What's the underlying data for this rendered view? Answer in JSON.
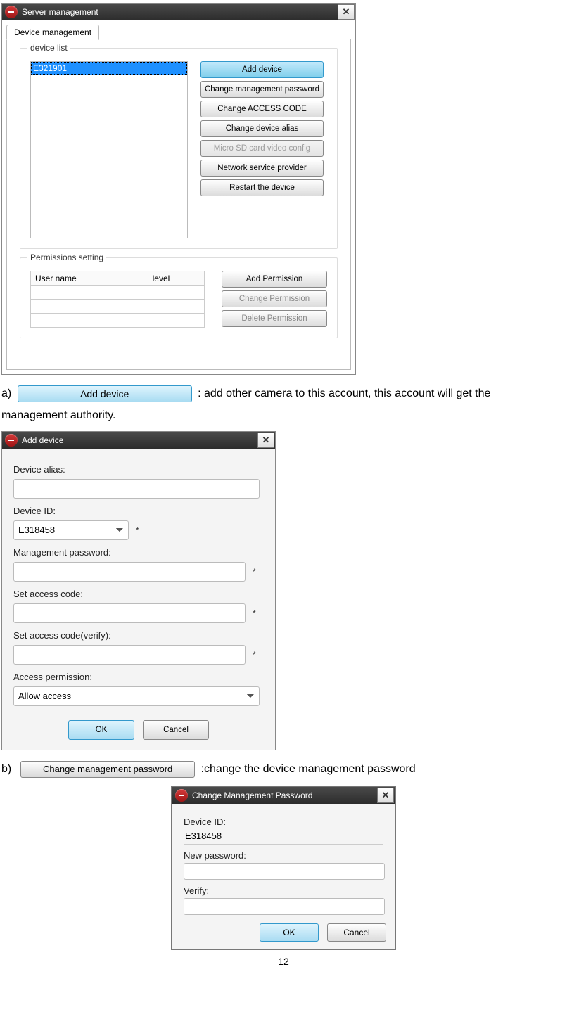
{
  "page_number": "12",
  "serverMgmt": {
    "title": "Server management",
    "tab": "Device management",
    "groupDeviceList": "device list",
    "deviceItems": [
      "E321901"
    ],
    "deviceButtons": {
      "add": "Add device",
      "changePwd": "Change management password",
      "changeAccess": "Change ACCESS CODE",
      "changeAlias": "Change device alias",
      "sd": "Micro SD card video config",
      "nsp": "Network service provider",
      "restart": "Restart the device"
    },
    "groupPermissions": "Permissions setting",
    "permHeaders": {
      "user": "User name",
      "level": "level"
    },
    "permButtons": {
      "add": "Add Permission",
      "change": "Change Permission",
      "delete": "Delete Permission"
    }
  },
  "proseA": {
    "prefix": "a)",
    "button": "Add device",
    "text1": ": add other camera to this account, this account will get the",
    "text2": "management authority."
  },
  "addDeviceDlg": {
    "title": "Add device",
    "labels": {
      "alias": "Device alias:",
      "id": "Device ID:",
      "mgmtPwd": "Management password:",
      "setCode": "Set access code:",
      "setCode2": "Set access code(verify):",
      "perm": "Access permission:"
    },
    "deviceId": "E318458",
    "permission": "Allow access",
    "ok": "OK",
    "cancel": "Cancel"
  },
  "proseB": {
    "prefix": "b)",
    "button": "Change management password",
    "text": ":change the device management password"
  },
  "cpwDlg": {
    "title": "Change Management Password",
    "labels": {
      "id": "Device ID:",
      "new": "New password:",
      "verify": "Verify:"
    },
    "deviceId": "E318458",
    "ok": "OK",
    "cancel": "Cancel"
  }
}
